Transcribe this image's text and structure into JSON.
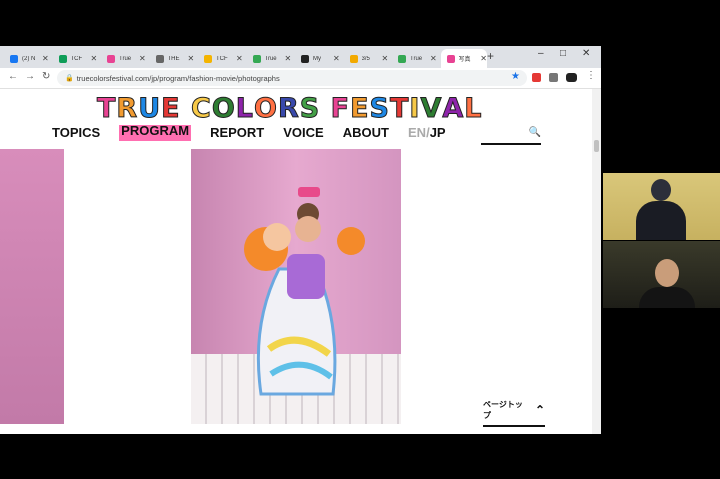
{
  "browser": {
    "tabs": [
      {
        "title": "(2) N",
        "favicon": "facebook-icon",
        "color": "#1877f2"
      },
      {
        "title": "TCF",
        "favicon": "sheets-icon",
        "color": "#0f9d58"
      },
      {
        "title": "True",
        "favicon": "tcf-icon",
        "color": "#e84393"
      },
      {
        "title": "THE",
        "favicon": "page-icon",
        "color": "#666666"
      },
      {
        "title": "TCF",
        "favicon": "slides-icon",
        "color": "#f4b400"
      },
      {
        "title": "True",
        "favicon": "green-icon",
        "color": "#34a853"
      },
      {
        "title": "My",
        "favicon": "bookmark-icon",
        "color": "#222222"
      },
      {
        "title": "3/5",
        "favicon": "folder-icon",
        "color": "#f2a900"
      },
      {
        "title": "True",
        "favicon": "green-icon",
        "color": "#34a853"
      },
      {
        "title": "写真",
        "favicon": "tcf-icon",
        "color": "#e84393",
        "active": true
      }
    ],
    "new_tab": "+",
    "url": "truecolorsfestival.com/jp/program/fashion-movie/photographs"
  },
  "site": {
    "logo": "TRUE COLORS FESTIVAL",
    "logo_colors": [
      "#e84393",
      "#f29b30",
      "#1e88e5",
      "#e53935",
      "#f7c948",
      "#2e7d32",
      "#8e24aa",
      "#ff7043",
      "#3949ab",
      "#43a047"
    ],
    "nav": [
      "TOPICS",
      "PROGRAM",
      "REPORT",
      "VOICE",
      "ABOUT"
    ],
    "nav_active_color": "#ff6fb1",
    "lang_en": "EN",
    "lang_sep": "/",
    "lang_jp": "JP",
    "page_top": "ページトップ"
  }
}
